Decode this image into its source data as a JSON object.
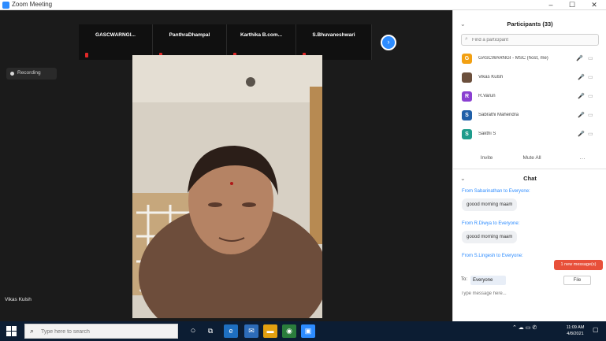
{
  "window": {
    "title": "Zoom Meeting",
    "minimize": "–",
    "maximize": "☐",
    "close": "✕"
  },
  "video": {
    "thumbnails": [
      "GASCWARNGI...",
      "PanthraDhampal",
      "Karthika B.com...",
      "S.Bhuvaneshwari"
    ],
    "next_icon": "›",
    "recording_label": "Recording",
    "speaker_name": "Vikas Kulsh"
  },
  "participants": {
    "title": "Participants (33)",
    "collapse_icon": "chevron-down",
    "search_placeholder": "Find a participant",
    "list": [
      {
        "name": "GASCWARNGI - MSC (host, me)",
        "initial": "G",
        "color": "#f2a012"
      },
      {
        "name": "Vikas Kulsh",
        "initial": "",
        "color": "#6b4f3c"
      },
      {
        "name": "R.Varun",
        "initial": "R",
        "color": "#8a3fd1"
      },
      {
        "name": "Sabrathi Mahendra",
        "initial": "S",
        "color": "#1f5fa8"
      },
      {
        "name": "Sakthi S",
        "initial": "S",
        "color": "#1d9c8c"
      }
    ],
    "invite_label": "Invite",
    "mute_all_label": "Mute All",
    "more_label": "…"
  },
  "chat": {
    "title": "Chat",
    "messages": [
      {
        "from": "From Sabarinathan to Everyone:",
        "text": "goood morning maam"
      },
      {
        "from": "From R.Diwya to Everyone:",
        "text": "goood morning maam"
      },
      {
        "from": "From S.Lingesh to Everyone:",
        "text": ""
      }
    ],
    "new_message_label": "1 new message(s)",
    "to_label": "To:",
    "to_value": "Everyone",
    "file_label": "File",
    "input_placeholder": "Type message here..."
  },
  "taskbar": {
    "search_placeholder": "Type here to search",
    "clock_time": "11:09 AM",
    "clock_date": "4/8/2021"
  }
}
